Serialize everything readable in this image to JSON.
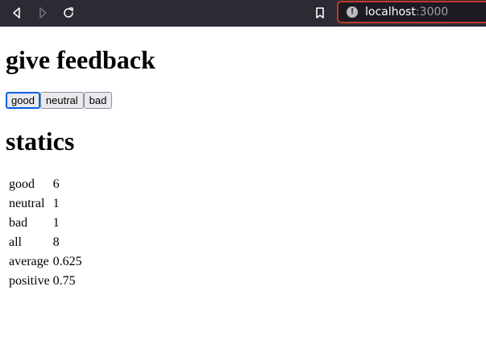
{
  "browser": {
    "url_host": "localhost",
    "url_port": ":3000",
    "icons": {
      "back": "back-arrow-icon",
      "forward": "forward-arrow-icon",
      "reload": "reload-icon",
      "bookmark": "bookmark-icon",
      "info": "info-icon"
    }
  },
  "page": {
    "feedback_title": "give feedback",
    "buttons": {
      "good": "good",
      "neutral": "neutral",
      "bad": "bad"
    },
    "stats_title": "statics",
    "stats": [
      {
        "label": "good",
        "value": "6"
      },
      {
        "label": "neutral",
        "value": "1"
      },
      {
        "label": "bad",
        "value": "1"
      },
      {
        "label": "all",
        "value": "8"
      },
      {
        "label": "average",
        "value": "0.625"
      },
      {
        "label": "positive",
        "value": "0.75"
      }
    ]
  },
  "colors": {
    "toolbar_bg": "#2b2b33",
    "url_border": "#c0392b",
    "focus_ring": "#0060df"
  }
}
